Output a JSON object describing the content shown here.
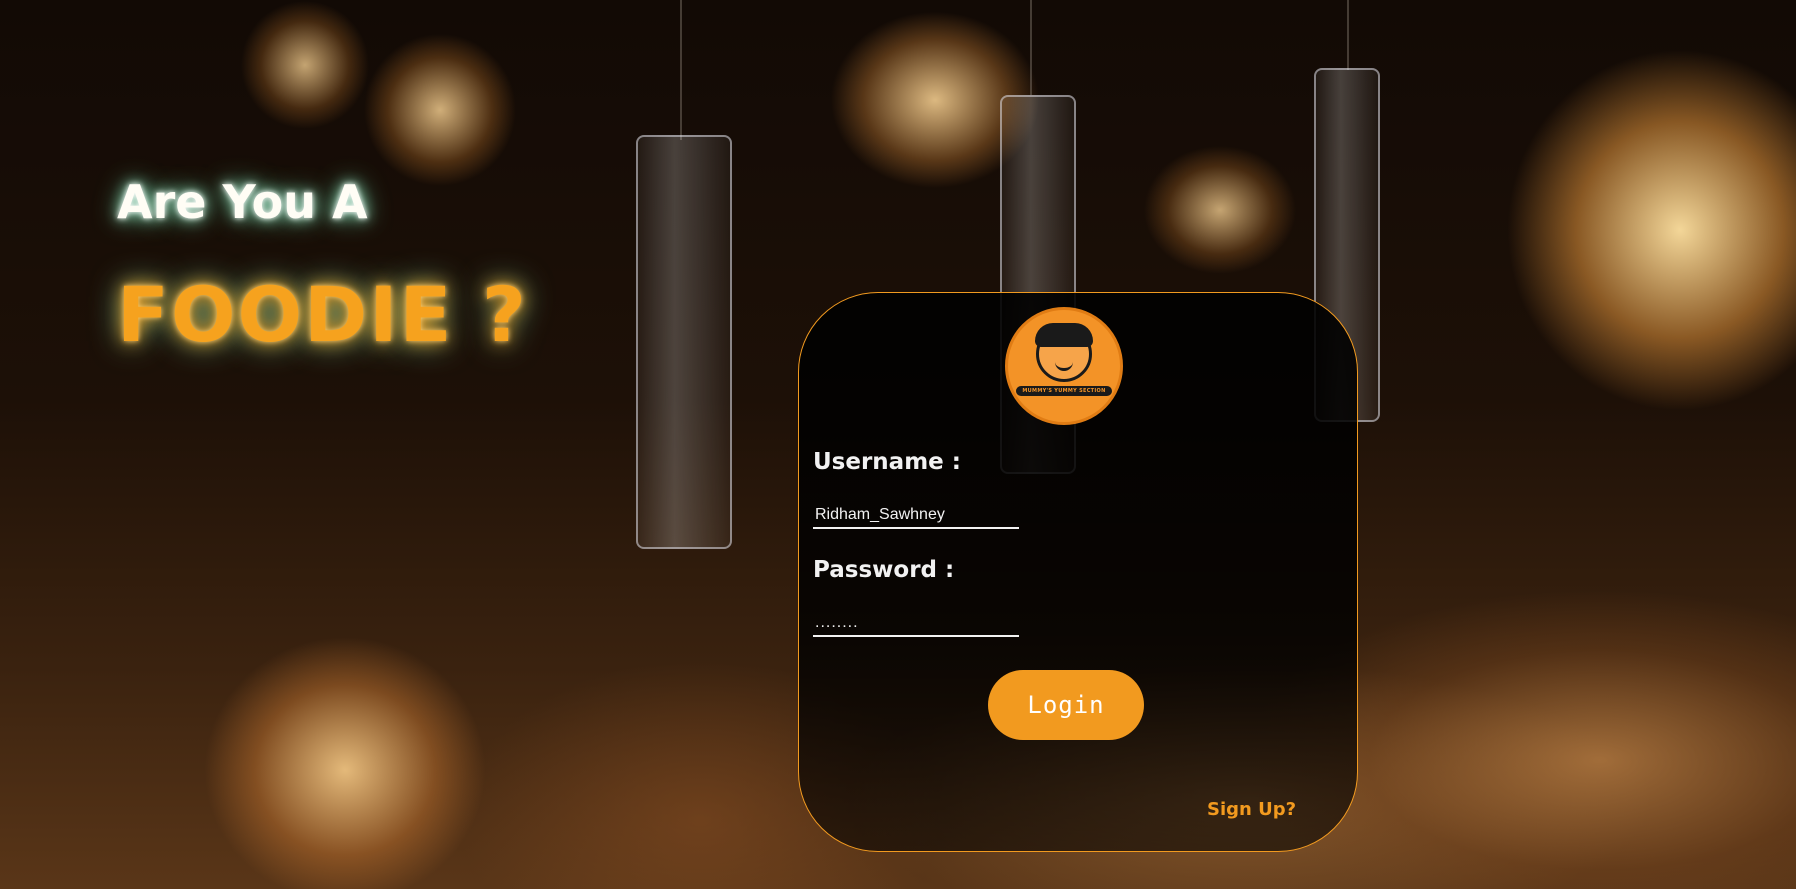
{
  "hero": {
    "line1": "Are You A",
    "line2": "FOODIE ?"
  },
  "login_form": {
    "logo_text": "MUMMY'S YUMMY SECTION",
    "username_label": "Username :",
    "username_value": "Ridham_Sawhney",
    "password_label": "Password :",
    "password_value": "........",
    "login_label": "Login",
    "signup_label": "Sign Up?"
  },
  "colors": {
    "accent": "#f29a1f",
    "hero_text": "#fffdf5",
    "card_bg": "#000000"
  },
  "icons": {
    "logo": "chef-boy-face-logo-icon"
  }
}
